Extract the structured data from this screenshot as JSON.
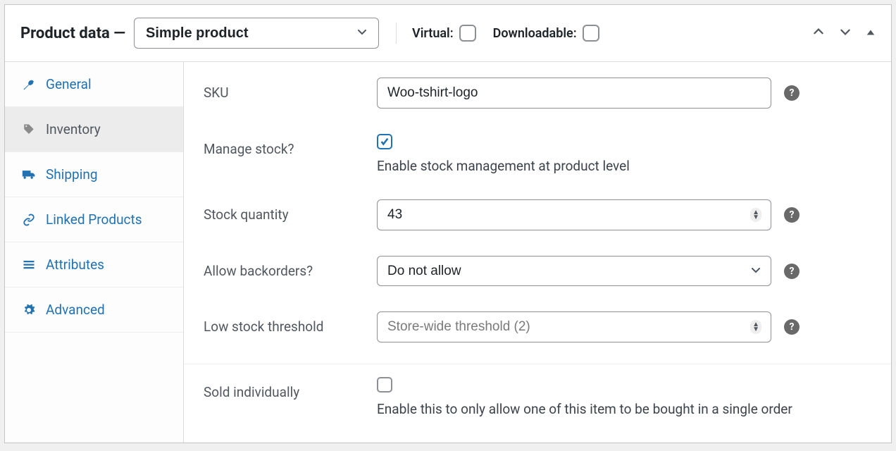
{
  "header": {
    "title": "Product data —",
    "product_type": "Simple product",
    "virtual_label": "Virtual:",
    "virtual_checked": false,
    "downloadable_label": "Downloadable:",
    "downloadable_checked": false
  },
  "tabs": [
    {
      "key": "general",
      "label": "General",
      "icon": "wrench-icon",
      "active": false
    },
    {
      "key": "inventory",
      "label": "Inventory",
      "icon": "tag-icon",
      "active": true
    },
    {
      "key": "shipping",
      "label": "Shipping",
      "icon": "truck-icon",
      "active": false
    },
    {
      "key": "linked",
      "label": "Linked Products",
      "icon": "link-icon",
      "active": false
    },
    {
      "key": "attributes",
      "label": "Attributes",
      "icon": "list-icon",
      "active": false
    },
    {
      "key": "advanced",
      "label": "Advanced",
      "icon": "gear-icon",
      "active": false
    }
  ],
  "form": {
    "sku": {
      "label": "SKU",
      "value": "Woo-tshirt-logo"
    },
    "manage_stock": {
      "label": "Manage stock?",
      "checked": true,
      "desc": "Enable stock management at product level"
    },
    "stock_qty": {
      "label": "Stock quantity",
      "value": "43"
    },
    "backorders": {
      "label": "Allow backorders?",
      "value": "Do not allow"
    },
    "low_stock": {
      "label": "Low stock threshold",
      "placeholder": "Store-wide threshold (2)",
      "value": ""
    },
    "sold_individually": {
      "label": "Sold individually",
      "checked": false,
      "desc": "Enable this to only allow one of this item to be bought in a single order"
    }
  }
}
